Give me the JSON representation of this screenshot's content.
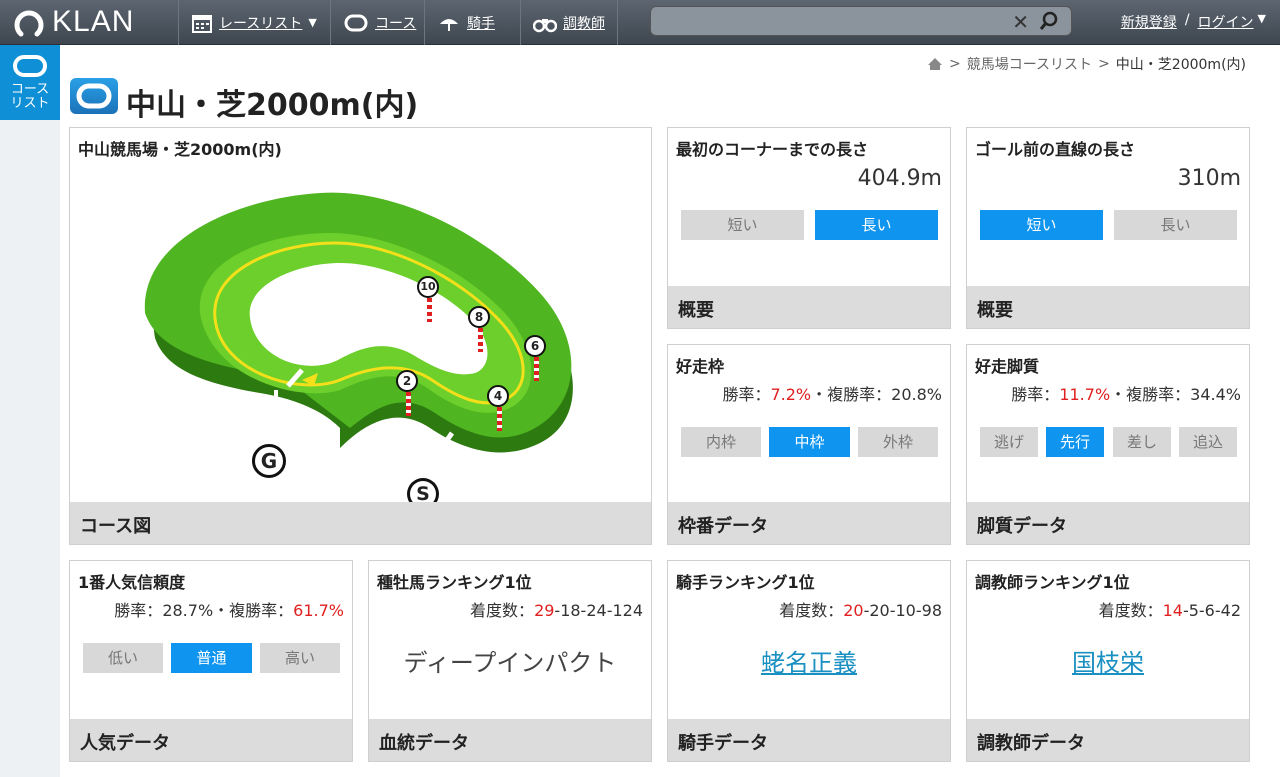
{
  "header": {
    "logo": "KLAN",
    "nav": [
      {
        "label": "レースリスト",
        "icon": "calendar-icon"
      },
      {
        "label": "コース",
        "icon": "course-icon"
      },
      {
        "label": "騎手",
        "icon": "jockey-icon"
      },
      {
        "label": "調教師",
        "icon": "binoculars-icon"
      }
    ],
    "search": {
      "placeholder": ""
    },
    "auth": {
      "register": "新規登録",
      "sep": "/",
      "login": "ログイン"
    }
  },
  "sidenav": {
    "item_label_1": "コース",
    "item_label_2": "リスト"
  },
  "breadcrumb": {
    "sep": ">",
    "level1": "競馬場コースリスト",
    "current": "中山・芝2000m(内)"
  },
  "page_title": "中山・芝2000m(内)",
  "course_map": {
    "title": "中山競馬場・芝2000m(内)",
    "footer": "コース図",
    "markers": [
      "10",
      "8",
      "6",
      "2",
      "4"
    ],
    "goal": "G",
    "start": "S"
  },
  "first_corner": {
    "title": "最初のコーナーまでの長さ",
    "value": "404.9m",
    "options": [
      "短い",
      "長い"
    ],
    "selected": 1,
    "footer": "概要"
  },
  "final_straight": {
    "title": "ゴール前の直線の長さ",
    "value": "310m",
    "options": [
      "短い",
      "長い"
    ],
    "selected": 0,
    "footer": "概要"
  },
  "gate": {
    "title": "好走枠",
    "win_label": "勝率：",
    "win": "7.2%",
    "sep": "・",
    "place_label": "複勝率：",
    "place": "20.8%",
    "options": [
      "内枠",
      "中枠",
      "外枠"
    ],
    "selected": 1,
    "footer": "枠番データ"
  },
  "style": {
    "title": "好走脚質",
    "win_label": "勝率：",
    "win": "11.7%",
    "sep": "・",
    "place_label": "複勝率：",
    "place": "34.4%",
    "options": [
      "逃げ",
      "先行",
      "差し",
      "追込"
    ],
    "selected": 1,
    "footer": "脚質データ"
  },
  "favorite": {
    "title": "1番人気信頼度",
    "win_label": "勝率：",
    "win": "28.7%",
    "sep": "・",
    "place_label": "複勝率：",
    "place": "61.7%",
    "options": [
      "低い",
      "普通",
      "高い"
    ],
    "selected": 1,
    "footer": "人気データ"
  },
  "sire": {
    "title": "種牡馬ランキング1位",
    "record_label": "着度数：",
    "first": "29",
    "rest": "-18-24-124",
    "name": "ディープインパクト",
    "footer": "血統データ"
  },
  "jockey": {
    "title": "騎手ランキング1位",
    "record_label": "着度数：",
    "first": "20",
    "rest": "-20-10-98",
    "name": "蛯名正義",
    "footer": "騎手データ"
  },
  "trainer": {
    "title": "調教師ランキング1位",
    "record_label": "着度数：",
    "first": "14",
    "rest": "-5-6-42",
    "name": "国枝栄",
    "footer": "調教師データ"
  }
}
